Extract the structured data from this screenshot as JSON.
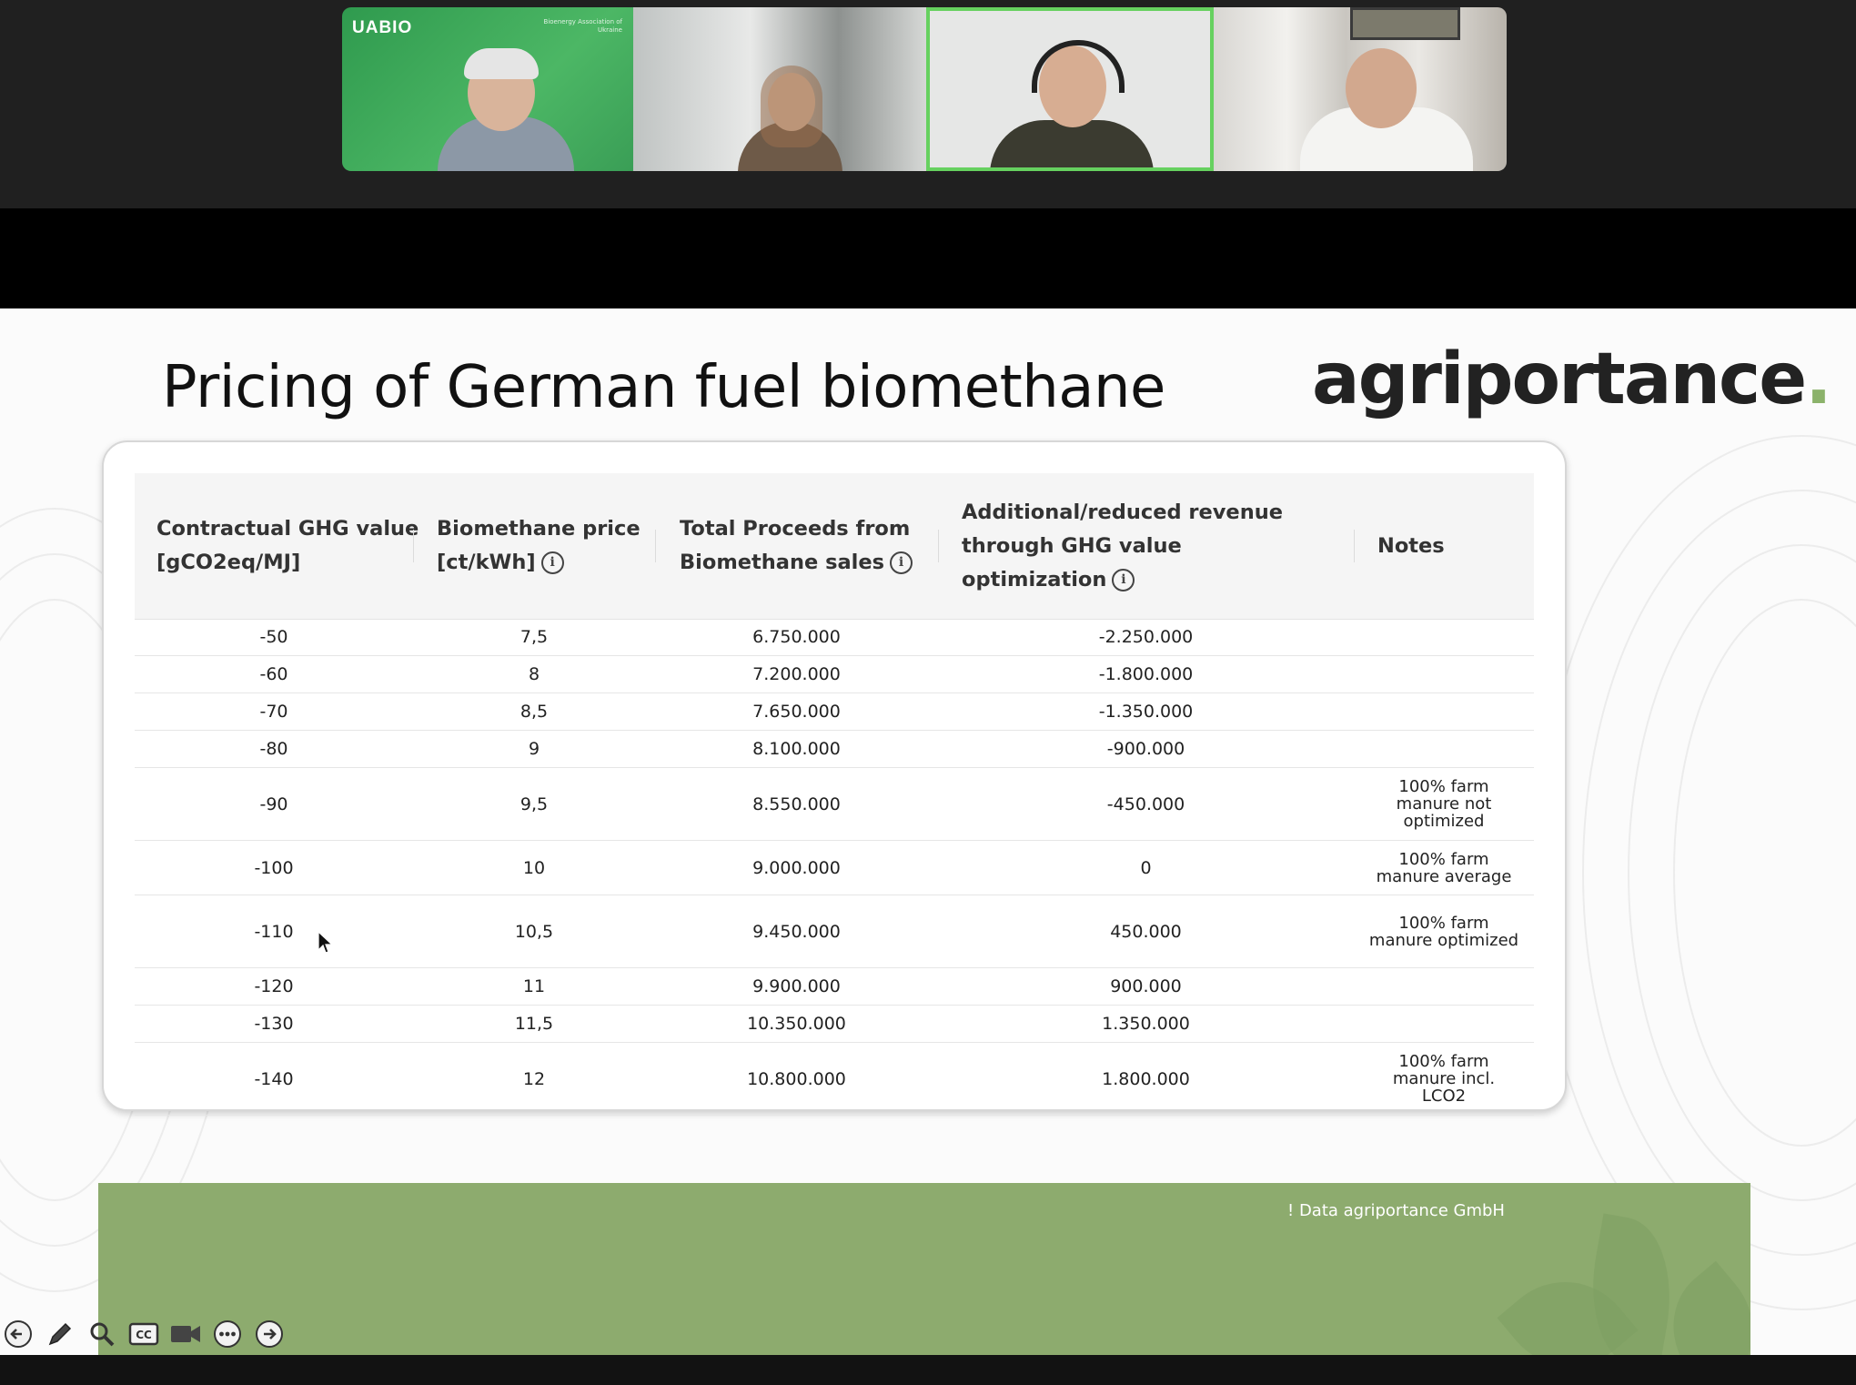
{
  "video_strip": {
    "tiles": [
      {
        "logo": "UABIO",
        "sub": "Bioenergy Association of Ukraine"
      },
      {
        "logo": "",
        "sub": ""
      },
      {
        "logo": "",
        "sub": ""
      },
      {
        "logo": "",
        "sub": ""
      }
    ],
    "active_speaker_color": "#66d15f"
  },
  "slide": {
    "title": "Pricing of German fuel biomethane",
    "brand": {
      "name": "agriportance",
      "dot": ".",
      "dot_color": "#8bb26a"
    },
    "table": {
      "headers": [
        {
          "text": "Contractual GHG value [gCO2eq/MJ]",
          "info": false
        },
        {
          "text": "Biomethane price [ct/kWh]",
          "info": true
        },
        {
          "text": "Total Proceeds from Biomethane sales",
          "info": true
        },
        {
          "text": "Additional/reduced revenue through GHG value optimization",
          "info": true
        },
        {
          "text": "Notes",
          "info": false
        }
      ],
      "info_glyph": "i",
      "rows": [
        {
          "ghg": "-50",
          "price": "7,5",
          "proceeds": "6.750.000",
          "revenue": "-2.250.000",
          "notes": ""
        },
        {
          "ghg": "-60",
          "price": "8",
          "proceeds": "7.200.000",
          "revenue": "-1.800.000",
          "notes": ""
        },
        {
          "ghg": "-70",
          "price": "8,5",
          "proceeds": "7.650.000",
          "revenue": "-1.350.000",
          "notes": ""
        },
        {
          "ghg": "-80",
          "price": "9",
          "proceeds": "8.100.000",
          "revenue": "-900.000",
          "notes": ""
        },
        {
          "ghg": "-90",
          "price": "9,5",
          "proceeds": "8.550.000",
          "revenue": "-450.000",
          "notes": "100% farm manure not optimized"
        },
        {
          "ghg": "-100",
          "price": "10",
          "proceeds": "9.000.000",
          "revenue": "0",
          "notes": "100% farm manure average"
        },
        {
          "ghg": "-110",
          "price": "10,5",
          "proceeds": "9.450.000",
          "revenue": "450.000",
          "notes": "100% farm manure optimized"
        },
        {
          "ghg": "-120",
          "price": "11",
          "proceeds": "9.900.000",
          "revenue": "900.000",
          "notes": ""
        },
        {
          "ghg": "-130",
          "price": "11,5",
          "proceeds": "10.350.000",
          "revenue": "1.350.000",
          "notes": ""
        },
        {
          "ghg": "-140",
          "price": "12",
          "proceeds": "10.800.000",
          "revenue": "1.800.000",
          "notes": "100% farm manure incl. LCO2"
        }
      ]
    },
    "footer": {
      "text": "! Data agriportance GmbH",
      "color": "#8dab6e"
    }
  },
  "controls": [
    {
      "icon": "back-arrow-icon"
    },
    {
      "icon": "pen-icon"
    },
    {
      "icon": "zoom-icon"
    },
    {
      "icon": "captions-icon",
      "label": "CC"
    },
    {
      "icon": "video-camera-icon"
    },
    {
      "icon": "more-icon"
    },
    {
      "icon": "forward-arrow-icon"
    }
  ]
}
